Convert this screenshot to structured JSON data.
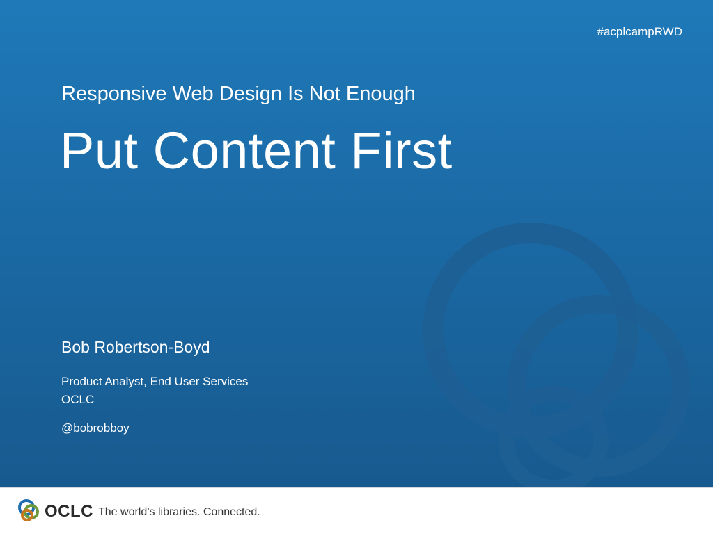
{
  "slide": {
    "hashtag": "#acplcampRWD",
    "subtitle": "Responsive Web Design Is Not Enough",
    "title": "Put Content First",
    "author": "Bob Robertson-Boyd",
    "role_line1": "Product Analyst, End User Services",
    "role_line2": "OCLC",
    "handle": "@bobrobboy"
  },
  "footer": {
    "logo_text": "OCLC",
    "tagline": "The world’s libraries. Connected."
  },
  "colors": {
    "background_blue": "#1b6aa6",
    "ring_blue": "#1d5c8e",
    "text": "#ffffff"
  },
  "icons": {
    "decorative_rings": "rings-decoration-icon",
    "logo_mark": "oclc-logo-icon"
  }
}
